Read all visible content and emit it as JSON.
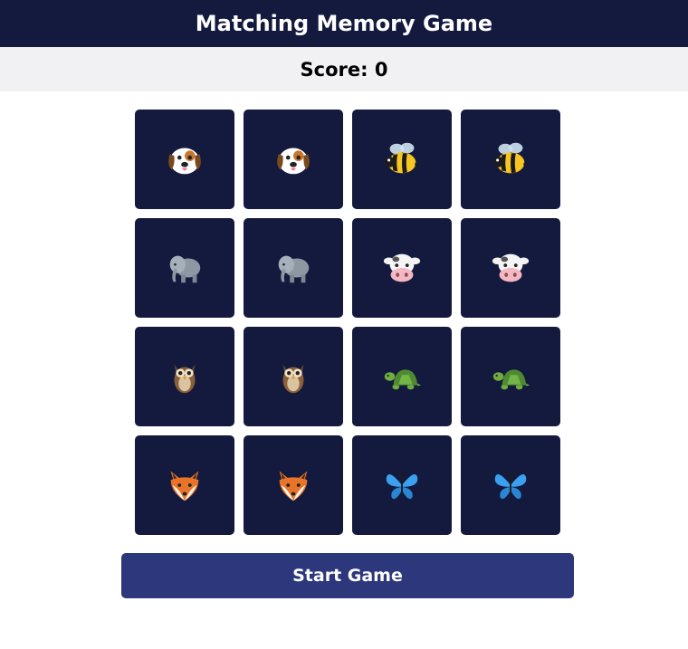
{
  "header": {
    "title": "Matching Memory Game"
  },
  "score": {
    "text": "Score: 0"
  },
  "cards": [
    {
      "icon": "dog-icon"
    },
    {
      "icon": "dog-icon"
    },
    {
      "icon": "bee-icon"
    },
    {
      "icon": "bee-icon"
    },
    {
      "icon": "elephant-icon"
    },
    {
      "icon": "elephant-icon"
    },
    {
      "icon": "cow-icon"
    },
    {
      "icon": "cow-icon"
    },
    {
      "icon": "owl-icon"
    },
    {
      "icon": "owl-icon"
    },
    {
      "icon": "turtle-icon"
    },
    {
      "icon": "turtle-icon"
    },
    {
      "icon": "fox-icon"
    },
    {
      "icon": "fox-icon"
    },
    {
      "icon": "butterfly-icon"
    },
    {
      "icon": "butterfly-icon"
    }
  ],
  "colors": {
    "header_bg": "#141a3d",
    "card_bg": "#141a3d",
    "button_bg": "#2c377c",
    "score_bg": "#f1f1f3"
  },
  "start_button": {
    "label": "Start Game"
  }
}
